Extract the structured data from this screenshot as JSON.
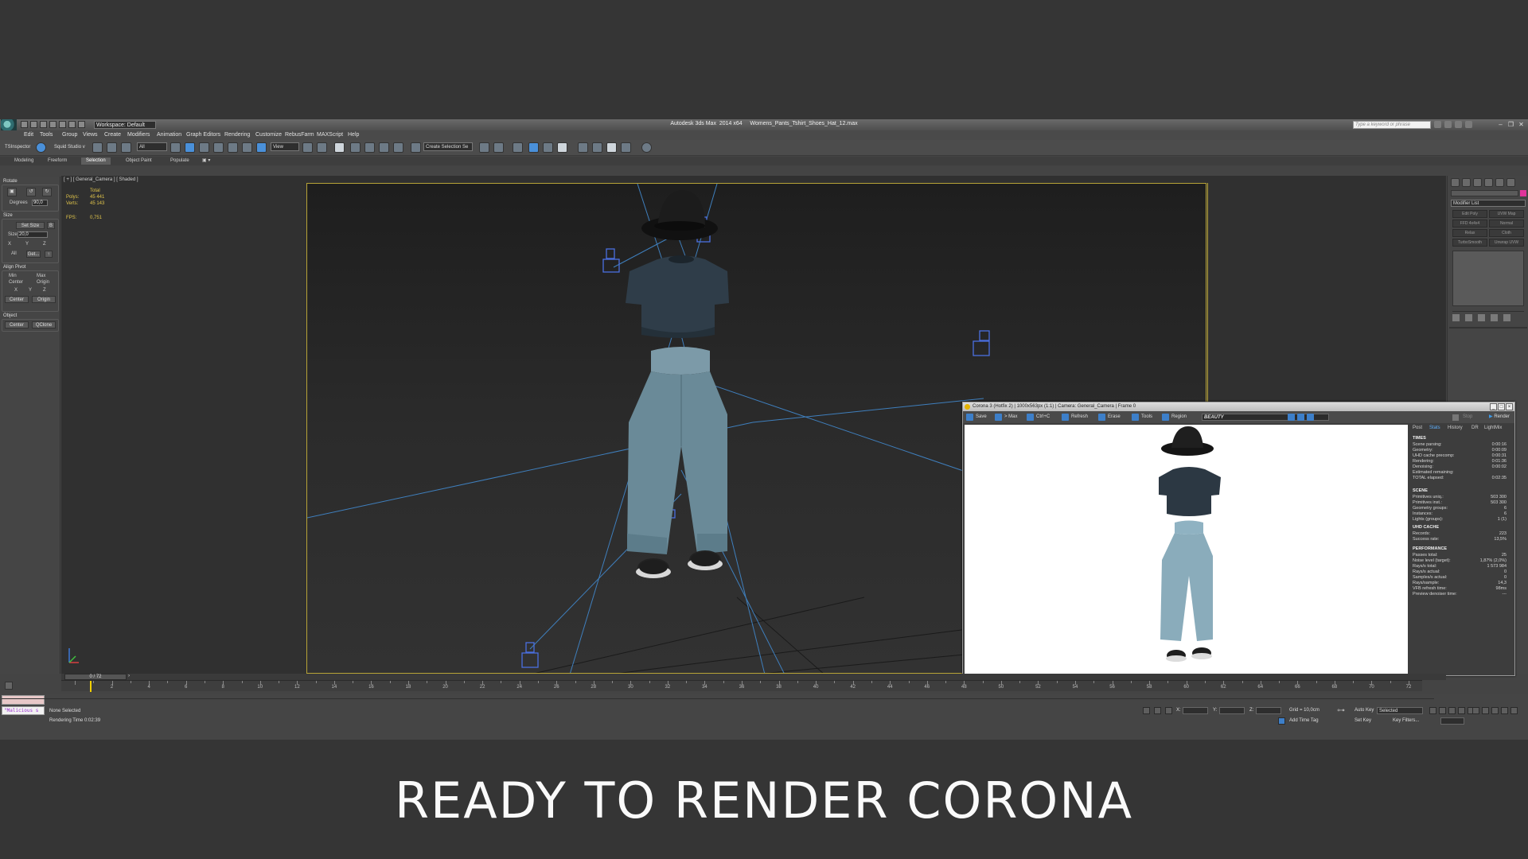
{
  "app": {
    "title": "Autodesk 3ds Max  2014 x64     Womens_Pants_Tshirt_Shoes_Hat_12.max",
    "workspace": "Workspace: Default",
    "search_placeholder": "Type a keyword or phrase"
  },
  "menu": [
    "Edit",
    "Tools",
    "Group",
    "Views",
    "Create",
    "Modifiers",
    "Animation",
    "Graph Editors",
    "Rendering",
    "Customize",
    "RebusFarm",
    "MAXScript",
    "Help"
  ],
  "toolbar": {
    "tsinspector": "TSInspector",
    "squid": "Squid Studio v",
    "filter": "All",
    "view": "View",
    "selection_set": "Create Selection Se"
  },
  "ribbon_tabs": [
    "Modeling",
    "Freeform",
    "Selection",
    "Object Paint",
    "Populate"
  ],
  "ribbon_active": "Selection",
  "left_panel": {
    "rotate": "Rotate",
    "degrees_label": "Degrees",
    "degrees": "90,0",
    "size": "Size",
    "set_size": "Set Size",
    "size_label": "Size",
    "size_value": "20,0",
    "x": "X",
    "y": "Y",
    "z": "Z",
    "all": "All",
    "get": "Get...",
    "align_pivot": "Align Pivot",
    "min": "Min",
    "max": "Max",
    "center": "Center",
    "origin": "Origin",
    "center_btn": "Center",
    "origin_btn": "Origin",
    "object": "Object",
    "center_obj": "Center",
    "qclone": "QClone"
  },
  "viewport": {
    "label": "[ + ] [ General_Camera ] [ Shaded ]",
    "stats_total": "Total",
    "polys_label": "Polys:",
    "polys": "45 441",
    "verts_label": "Verts:",
    "verts": "45 143",
    "fps_label": "FPS:",
    "fps": "0,751"
  },
  "right_panel": {
    "modifier_list": "Modifier List",
    "buttons": [
      "Edit Poly",
      "UVW Map",
      "FFD 4x4x4",
      "Normal",
      "Relax",
      "Cloth",
      "TurboSmooth",
      "Unwrap UVW"
    ]
  },
  "vfb": {
    "title": "Corona 3 (Hotfix 2) | 1000x563px (1:1) | Camera: General_Camera | Frame 0",
    "toolbar": [
      "Save",
      "> Max",
      "Ctrl+C",
      "Refresh",
      "Erase",
      "Tools",
      "Region"
    ],
    "channel": "BEAUTY",
    "stop": "Stop",
    "render": "Render",
    "tabs": [
      "Post",
      "Stats",
      "History",
      "DR",
      "LightMix"
    ],
    "active_tab": "Stats",
    "times_h": "TIMES",
    "times": [
      {
        "k": "Scene parsing:",
        "v": "0:00:16"
      },
      {
        "k": "Geometry:",
        "v": "0:00:09"
      },
      {
        "k": "UHD cache precomp:",
        "v": "0:00:31"
      },
      {
        "k": "Rendering:",
        "v": "0:01:36"
      },
      {
        "k": "Denoising:",
        "v": "0:00:02"
      },
      {
        "k": "Estimated remaining:",
        "v": ""
      },
      {
        "k": "TOTAL elapsed:",
        "v": "0:02:35"
      }
    ],
    "scene_h": "SCENE",
    "scene": [
      {
        "k": "Primitives uniq.:",
        "v": "503 300"
      },
      {
        "k": "Primitives inst.:",
        "v": "503 300"
      },
      {
        "k": "Geometry groups:",
        "v": "6"
      },
      {
        "k": "Instances:",
        "v": "6"
      },
      {
        "k": "Lights (groups):",
        "v": "1 (1)"
      }
    ],
    "uhd_h": "UHD CACHE",
    "uhd": [
      {
        "k": "Records:",
        "v": "223"
      },
      {
        "k": "Success rate:",
        "v": "13,5%"
      }
    ],
    "perf_h": "PERFORMANCE",
    "perf": [
      {
        "k": "Passes total:",
        "v": "25"
      },
      {
        "k": "Noise level (target):",
        "v": "1,87% (2,0%)"
      },
      {
        "k": "Rays/s total:",
        "v": "1 573 984"
      },
      {
        "k": "Rays/s actual:",
        "v": "0"
      },
      {
        "k": "Samples/s actual:",
        "v": "0"
      },
      {
        "k": "Rays/sample:",
        "v": "14,3"
      },
      {
        "k": "VFB refresh time:",
        "v": "98ms"
      },
      {
        "k": "Preview denoiser time:",
        "v": "---"
      }
    ]
  },
  "timeline": {
    "frame": "0 / 72",
    "ticks": [
      "2",
      "4",
      "6",
      "8",
      "10",
      "12",
      "14",
      "16",
      "18",
      "20",
      "22",
      "24",
      "26",
      "28",
      "30",
      "32",
      "34",
      "36",
      "38",
      "40",
      "42",
      "44",
      "46",
      "48",
      "50",
      "52",
      "54",
      "56",
      "58",
      "60",
      "62",
      "64",
      "66",
      "68",
      "70",
      "72"
    ]
  },
  "status": {
    "maxscript": "\"Malicious s",
    "selection": "None Selected",
    "render_time": "Rendering Time  0:02:39",
    "x_label": "X:",
    "y_label": "Y:",
    "z_label": "Z:",
    "grid": "Grid = 10,0cm",
    "add_time_tag": "Add Time Tag",
    "auto_key": "Auto Key",
    "selected": "Selected",
    "set_key": "Set Key",
    "key_filters": "Key Filters..."
  },
  "caption": "READY TO RENDER  CORONA",
  "colors": {
    "accent_yellow": "#b7a337",
    "camera_blue": "#3d7fc9",
    "active_tab_blue": "#5fb0ff"
  }
}
